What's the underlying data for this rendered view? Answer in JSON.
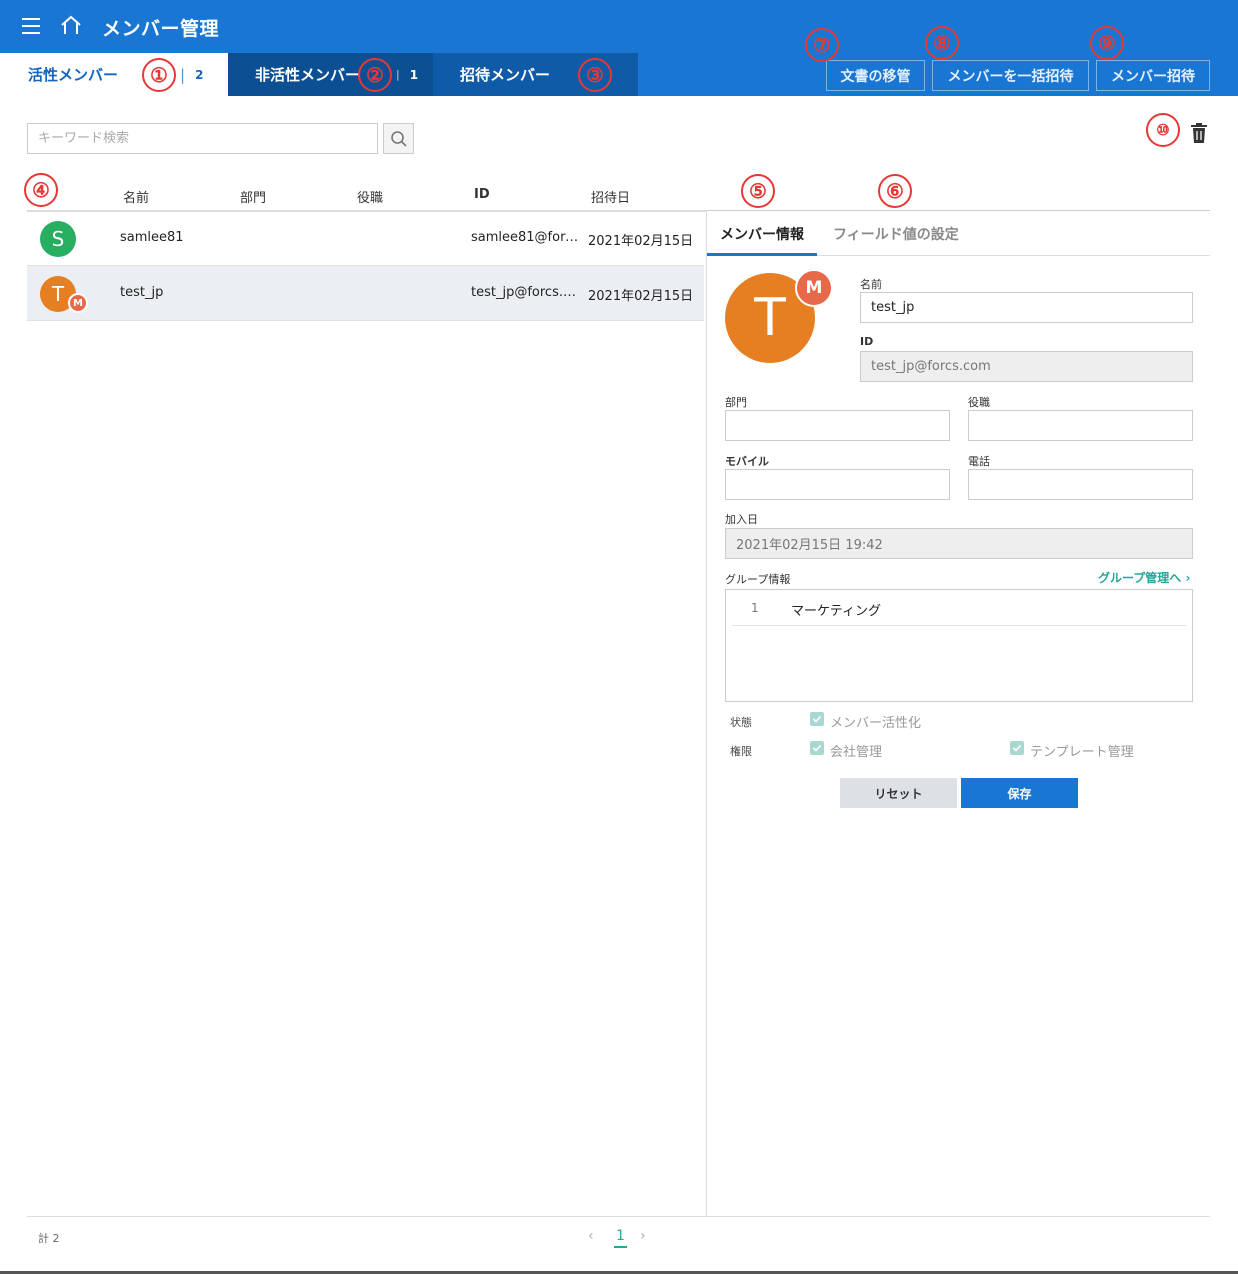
{
  "app": {
    "title": "メンバー管理"
  },
  "tabs": {
    "active": {
      "label": "活性メンバー",
      "count": "2"
    },
    "inactive": {
      "label": "非活性メンバー",
      "count": "1"
    },
    "invite": {
      "label": "招待メンバー"
    },
    "separator": "|"
  },
  "toolbar": {
    "transfer_label": "文書の移管",
    "bulk_invite_label": "メンバーを一括招待",
    "invite_label": "メンバー招待"
  },
  "markers": [
    "①",
    "②",
    "③",
    "④",
    "⑤",
    "⑥",
    "⑦",
    "⑧",
    "⑨",
    "⑩"
  ],
  "search": {
    "placeholder": "キーワード検索"
  },
  "table": {
    "headers": {
      "name": "名前",
      "dept": "部門",
      "title": "役職",
      "id": "ID",
      "invited": "招待日"
    },
    "rows": [
      {
        "initial": "S",
        "avatar_color": "#27ae60",
        "name": "samlee81",
        "id": "samlee81@forcs…",
        "date": "2021年02月15日",
        "badge": ""
      },
      {
        "initial": "T",
        "avatar_color": "#e67e22",
        "name": "test_jp",
        "id": "test_jp@forcs.c…",
        "date": "2021年02月15日",
        "badge": "M"
      }
    ]
  },
  "detail": {
    "tab_info": "メンバー情報",
    "tab_fields": "フィールド値の設定",
    "avatar_initial": "T",
    "avatar_badge": "M",
    "name_label": "名前",
    "name_value": "test_jp",
    "id_label": "ID",
    "id_value": "test_jp@forcs.com",
    "dept_label": "部門",
    "dept_value": "",
    "title_label": "役職",
    "title_value": "",
    "mobile_label": "モバイル",
    "mobile_value": "",
    "phone_label": "電話",
    "phone_value": "",
    "joined_label": "加入日",
    "joined_value": "2021年02月15日 19:42",
    "group_label": "グループ情報",
    "group_link": "グループ管理へ ›",
    "groups": [
      {
        "num": "1",
        "name": "マーケティング"
      }
    ],
    "status_label": "状態",
    "status_option": "メンバー活性化",
    "perm_label": "権限",
    "perm_company": "会社管理",
    "perm_template": "テンプレート管理",
    "reset_label": "リセット",
    "save_label": "保存"
  },
  "footer": {
    "total": "計 2",
    "page": "1",
    "prev": "‹",
    "next": "›"
  },
  "colors": {
    "header": "#1976d2",
    "accent_teal": "#26a69a",
    "marker": "#e53935"
  }
}
